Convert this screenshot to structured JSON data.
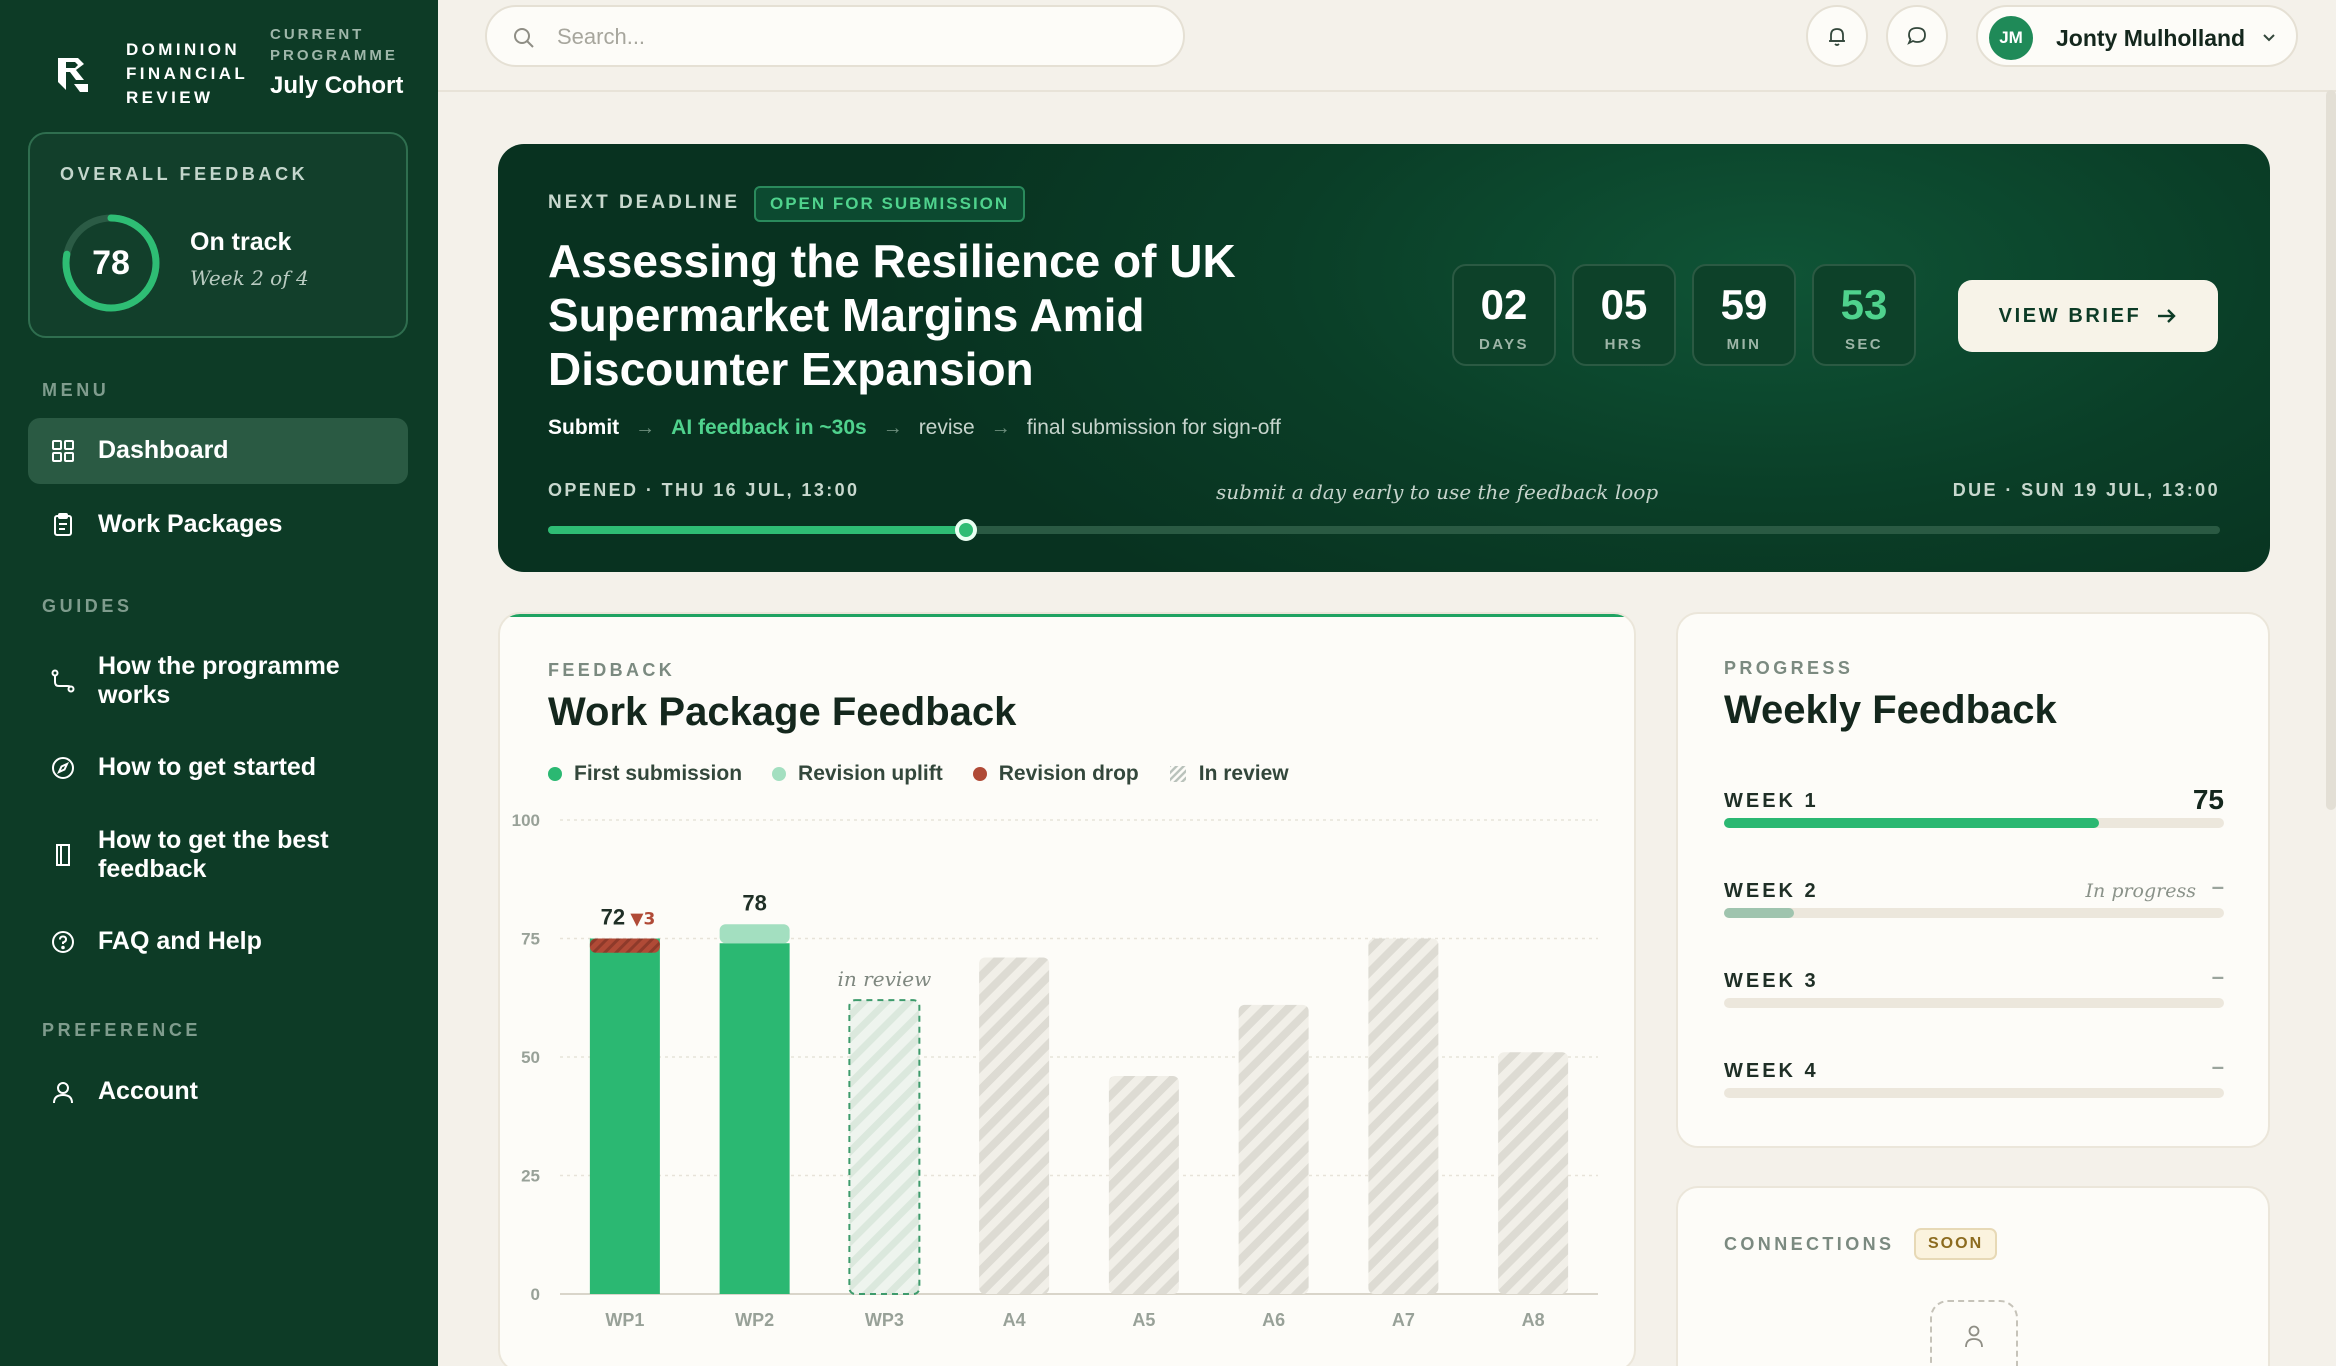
{
  "brand": {
    "lines": [
      "DOMINION",
      "FINANCIAL",
      "REVIEW"
    ],
    "programme_label_lines": [
      "CURRENT",
      "PROGRAMME"
    ],
    "programme_name": "July Cohort"
  },
  "overall": {
    "label": "OVERALL FEEDBACK",
    "score": "78",
    "score_fraction": 0.78,
    "status": "On track",
    "week": "Week 2 of 4"
  },
  "sidebar": {
    "menu_label": "MENU",
    "menu": [
      {
        "label": "Dashboard",
        "icon": "grid-icon",
        "active": true
      },
      {
        "label": "Work Packages",
        "icon": "clipboard-icon",
        "active": false
      }
    ],
    "guides_label": "GUIDES",
    "guides": [
      {
        "label_lines": [
          "How the programme",
          "works"
        ],
        "icon": "route-icon"
      },
      {
        "label_lines": [
          "How to get started"
        ],
        "icon": "compass-icon"
      },
      {
        "label_lines": [
          "How to get the best",
          "feedback"
        ],
        "icon": "book-icon"
      },
      {
        "label_lines": [
          "FAQ and Help"
        ],
        "icon": "help-circle-icon"
      }
    ],
    "preference_label": "PREFERENCE",
    "preference": [
      {
        "label": "Account",
        "icon": "user-icon"
      }
    ]
  },
  "topbar": {
    "search_placeholder": "Search...",
    "search_value": "",
    "user_initials": "JM",
    "user_name": "Jonty Mulholland"
  },
  "deadline": {
    "eyebrow": "NEXT DEADLINE",
    "badge": "OPEN FOR SUBMISSION",
    "title_lines": [
      "Assessing the Resilience of UK",
      "Supermarket Margins Amid",
      "Discounter Expansion"
    ],
    "flow": [
      "Submit",
      "AI feedback in ~30s",
      "revise",
      "final submission for sign-off"
    ],
    "opened": "OPENED · THU 16 JUL, 13:00",
    "hint": "submit a day early to use the feedback loop",
    "due": "DUE · SUN 19 JUL, 13:00",
    "progress": 0.25,
    "countdown": [
      {
        "value": "02",
        "unit": "DAYS"
      },
      {
        "value": "05",
        "unit": "HRS"
      },
      {
        "value": "59",
        "unit": "MIN"
      },
      {
        "value": "53",
        "unit": "SEC"
      }
    ],
    "button": "VIEW BRIEF"
  },
  "feedback_card": {
    "eyebrow": "FEEDBACK",
    "title": "Work Package Feedback",
    "legend": [
      "First submission",
      "Revision uplift",
      "Revision drop",
      "In review"
    ]
  },
  "chart_data": {
    "type": "bar",
    "categories": [
      "WP1",
      "WP2",
      "WP3",
      "A4",
      "A5",
      "A6",
      "A7",
      "A8"
    ],
    "ylim": [
      0,
      100
    ],
    "yticks": [
      0,
      25,
      50,
      75,
      100
    ],
    "series": [
      {
        "name": "First submission",
        "values": [
          75,
          74,
          null,
          null,
          null,
          null,
          null,
          null
        ]
      },
      {
        "name": "Revision uplift",
        "values": [
          null,
          4,
          null,
          null,
          null,
          null,
          null,
          null
        ]
      },
      {
        "name": "Revision drop",
        "values": [
          3,
          null,
          null,
          null,
          null,
          null,
          null,
          null
        ]
      },
      {
        "name": "In review",
        "values": [
          null,
          null,
          62,
          71,
          46,
          61,
          75,
          51
        ]
      }
    ],
    "data_labels": [
      {
        "category": "WP1",
        "text": "72",
        "delta": "▼3"
      },
      {
        "category": "WP2",
        "text": "78",
        "delta": ""
      }
    ],
    "annotation": {
      "category": "WP3",
      "text": "in review"
    },
    "grid": true,
    "colors": {
      "first": "#2bb872",
      "uplift": "#a3dfc0",
      "drop": "#b04a36",
      "review_dashed": "#3e9b6c",
      "hatch": "#dddbd3"
    }
  },
  "weekly": {
    "eyebrow": "PROGRESS",
    "title": "Weekly Feedback",
    "weeks": [
      {
        "label": "WEEK 1",
        "score": "75",
        "status": "",
        "progress": 0.75,
        "color": "#2bb872"
      },
      {
        "label": "WEEK 2",
        "score": "",
        "status": "In progress",
        "dash": "–",
        "progress": 0.14,
        "color": "#9fc4ae"
      },
      {
        "label": "WEEK 3",
        "score": "",
        "status": "",
        "dash": "–",
        "progress": 0,
        "color": "#9fc4ae"
      },
      {
        "label": "WEEK 4",
        "score": "",
        "status": "",
        "dash": "–",
        "progress": 0,
        "color": "#9fc4ae"
      }
    ]
  },
  "connections": {
    "label": "CONNECTIONS",
    "badge": "SOON"
  }
}
